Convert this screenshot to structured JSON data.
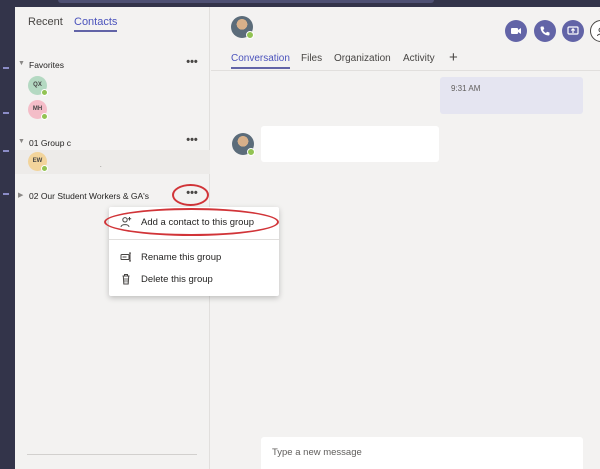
{
  "sidebar": {
    "tabs": [
      {
        "label": "Recent"
      },
      {
        "label": "Contacts"
      }
    ],
    "groups": [
      {
        "label": "Favorites",
        "more": "•••"
      },
      {
        "label": "01 Group c",
        "more": "•••"
      },
      {
        "label": "02 Our Student Workers & GA's",
        "more": "•••"
      }
    ],
    "favorites": [
      {
        "initials": "QX",
        "color": "#b4d9c2"
      },
      {
        "initials": "MH",
        "color": "#f4bdc8"
      }
    ],
    "group1_contacts": [
      {
        "initials": "EW",
        "color": "#f2d49b"
      }
    ]
  },
  "context_menu": {
    "items": [
      {
        "label": "Add a contact to this group",
        "icon": "add-person-icon"
      },
      {
        "label": "Rename this group",
        "icon": "rename-icon"
      },
      {
        "label": "Delete this group",
        "icon": "trash-icon"
      }
    ]
  },
  "chat": {
    "tabs": [
      {
        "label": "Conversation"
      },
      {
        "label": "Files"
      },
      {
        "label": "Organization"
      },
      {
        "label": "Activity"
      }
    ],
    "add_tab": "+",
    "timestamp": "9:31 AM",
    "compose_placeholder": "Type a new message",
    "actions": [
      "video-call-icon",
      "audio-call-icon",
      "screen-share-icon",
      "add-people-icon"
    ]
  },
  "colors": {
    "accent": "#6264a7",
    "rail": "#33344a",
    "presence_available": "#92c353",
    "annotation_red": "#d13438"
  }
}
